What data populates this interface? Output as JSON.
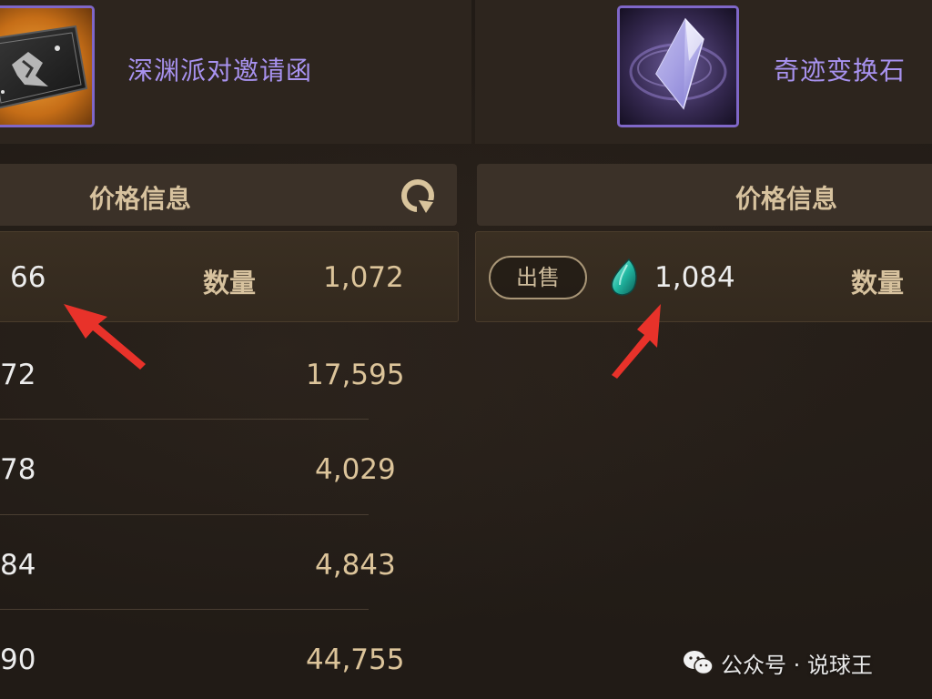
{
  "left_item": {
    "name": "深渊派对邀请函",
    "icon": "abyss-party-invitation-icon",
    "border_color": "#7f67c8"
  },
  "right_item": {
    "name": "奇迹变换石",
    "icon": "miracle-transform-stone-icon",
    "border_color": "#7f67c8"
  },
  "left_panel": {
    "header_title": "价格信息",
    "refresh_icon": "refresh-icon",
    "first_row": {
      "price": "66",
      "qty_label": "数量",
      "qty": "1,072"
    },
    "rows": [
      {
        "price": "72",
        "qty": "17,595"
      },
      {
        "price": "78",
        "qty": "4,029"
      },
      {
        "price": "84",
        "qty": "4,843"
      },
      {
        "price": "90",
        "qty": "44,755"
      }
    ]
  },
  "right_panel": {
    "header_title": "价格信息",
    "first_row": {
      "sell_label": "出售",
      "currency_icon": "gem-icon",
      "price": "1,084",
      "qty_label": "数量"
    }
  },
  "annotations": {
    "arrow_color": "#e8322a"
  },
  "watermark": {
    "icon": "wechat-icon",
    "text": "公众号 · 说球王"
  }
}
